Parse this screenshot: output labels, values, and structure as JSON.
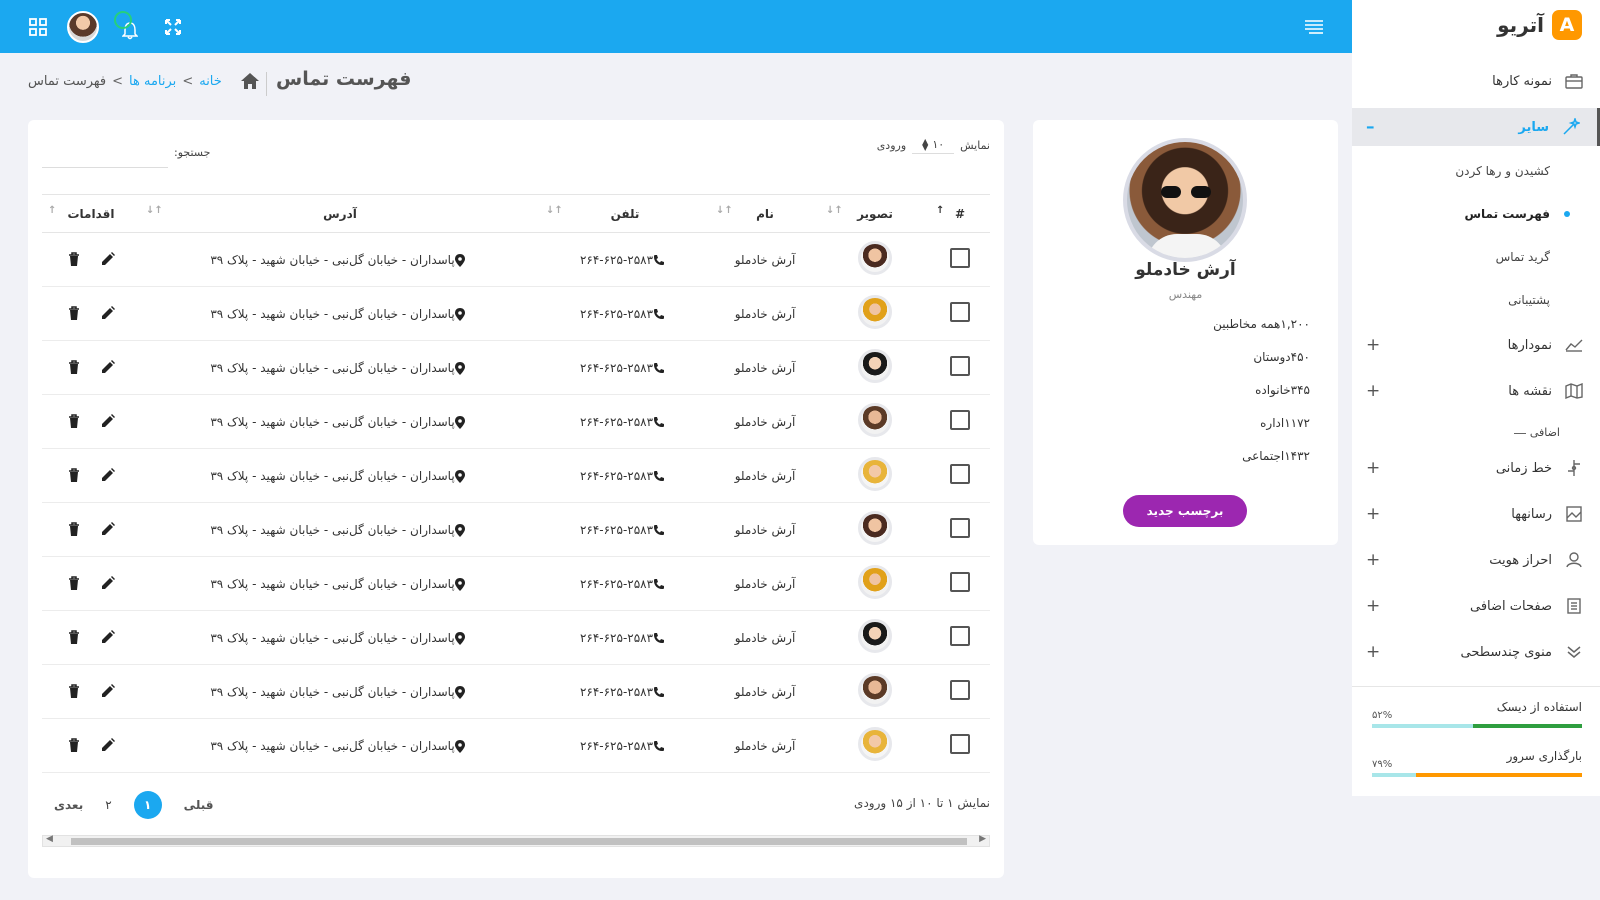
{
  "brand": {
    "name": "آتریو",
    "logo_letter": "A",
    "logo_color": "#ff9800"
  },
  "colors": {
    "topbar": "#1ba8f0",
    "accent": "#1ba8f0",
    "button": "#9c27b0"
  },
  "topbar": {
    "icons": [
      "hamburger-icon",
      "grid-icon",
      "avatar",
      "bell-icon",
      "expand-icon"
    ]
  },
  "page": {
    "title": "فهرست تماس"
  },
  "breadcrumb": {
    "home": "خانه",
    "apps": "برنامه ها",
    "current": "فهرست تماس",
    "separator": ">"
  },
  "sidebar": {
    "portfolio": "نمونه کارها",
    "other": "سایر",
    "other_collapse": "–",
    "sub": {
      "drag_drop": "کشیدن و رها کردن",
      "contact_list": "فهرست تماس",
      "contact_grid": "گرید تماس",
      "support": "پشتیبانی"
    },
    "charts": "نمودارها",
    "maps": "نقشه ها",
    "extra_label": "اضافی",
    "timeline": "خط زمانی",
    "media": "رسانهها",
    "auth": "احراز هویت",
    "extra_pages": "صفحات اضافی",
    "multilevel": "منوی چندسطحی",
    "plus": "+"
  },
  "meters": {
    "disk": {
      "label": "استفاده از دیسک",
      "pct_label": "۵۲%",
      "value": 0.52,
      "color": "#2e9e3f"
    },
    "server": {
      "label": "بارگذاری سرور",
      "pct_label": "۷۹%",
      "value": 0.79,
      "color": "#ff9800"
    }
  },
  "profile": {
    "name": "آرش خادملو",
    "role": "مهندس",
    "stats": [
      "۱,۲۰۰همه مخاطبین",
      "۴۵۰دوستان",
      "۳۴۵خانواده",
      "۱۱۷۲اداره",
      "۱۴۳۲اجتماعی"
    ],
    "button": "برچسب جدید"
  },
  "table": {
    "show_label": "نمایش",
    "page_size": "۱۰",
    "entries_label": "ورودی",
    "search_label": "جستجو:",
    "headers": {
      "num": "#",
      "photo": "تصویر",
      "name": "نام",
      "phone": "تلفن",
      "address": "آدرس",
      "actions": "اقدامات"
    },
    "rows": [
      {
        "avatar": "av1",
        "name": "آرش خادملو",
        "phone": "۲۶۴-۶۲۵-۲۵۸۳",
        "address": "پاسداران - خیابان گل‌نبی - خیابان شهید - پلاک ۳۹"
      },
      {
        "avatar": "av2",
        "name": "آرش خادملو",
        "phone": "۲۶۴-۶۲۵-۲۵۸۳",
        "address": "پاسداران - خیابان گل‌نبی - خیابان شهید - پلاک ۳۹"
      },
      {
        "avatar": "av3",
        "name": "آرش خادملو",
        "phone": "۲۶۴-۶۲۵-۲۵۸۳",
        "address": "پاسداران - خیابان گل‌نبی - خیابان شهید - پلاک ۳۹"
      },
      {
        "avatar": "av4",
        "name": "آرش خادملو",
        "phone": "۲۶۴-۶۲۵-۲۵۸۳",
        "address": "پاسداران - خیابان گل‌نبی - خیابان شهید - پلاک ۳۹"
      },
      {
        "avatar": "av5",
        "name": "آرش خادملو",
        "phone": "۲۶۴-۶۲۵-۲۵۸۳",
        "address": "پاسداران - خیابان گل‌نبی - خیابان شهید - پلاک ۳۹"
      },
      {
        "avatar": "av1",
        "name": "آرش خادملو",
        "phone": "۲۶۴-۶۲۵-۲۵۸۳",
        "address": "پاسداران - خیابان گل‌نبی - خیابان شهید - پلاک ۳۹"
      },
      {
        "avatar": "av2",
        "name": "آرش خادملو",
        "phone": "۲۶۴-۶۲۵-۲۵۸۳",
        "address": "پاسداران - خیابان گل‌نبی - خیابان شهید - پلاک ۳۹"
      },
      {
        "avatar": "av3",
        "name": "آرش خادملو",
        "phone": "۲۶۴-۶۲۵-۲۵۸۳",
        "address": "پاسداران - خیابان گل‌نبی - خیابان شهید - پلاک ۳۹"
      },
      {
        "avatar": "av4",
        "name": "آرش خادملو",
        "phone": "۲۶۴-۶۲۵-۲۵۸۳",
        "address": "پاسداران - خیابان گل‌نبی - خیابان شهید - پلاک ۳۹"
      },
      {
        "avatar": "av5",
        "name": "آرش خادملو",
        "phone": "۲۶۴-۶۲۵-۲۵۸۳",
        "address": "پاسداران - خیابان گل‌نبی - خیابان شهید - پلاک ۳۹"
      }
    ],
    "info": "نمایش ۱ تا ۱۰ از ۱۵ ورودی",
    "pagination": {
      "prev": "قبلی",
      "current": "۱",
      "page2": "۲",
      "next": "بعدی"
    }
  }
}
